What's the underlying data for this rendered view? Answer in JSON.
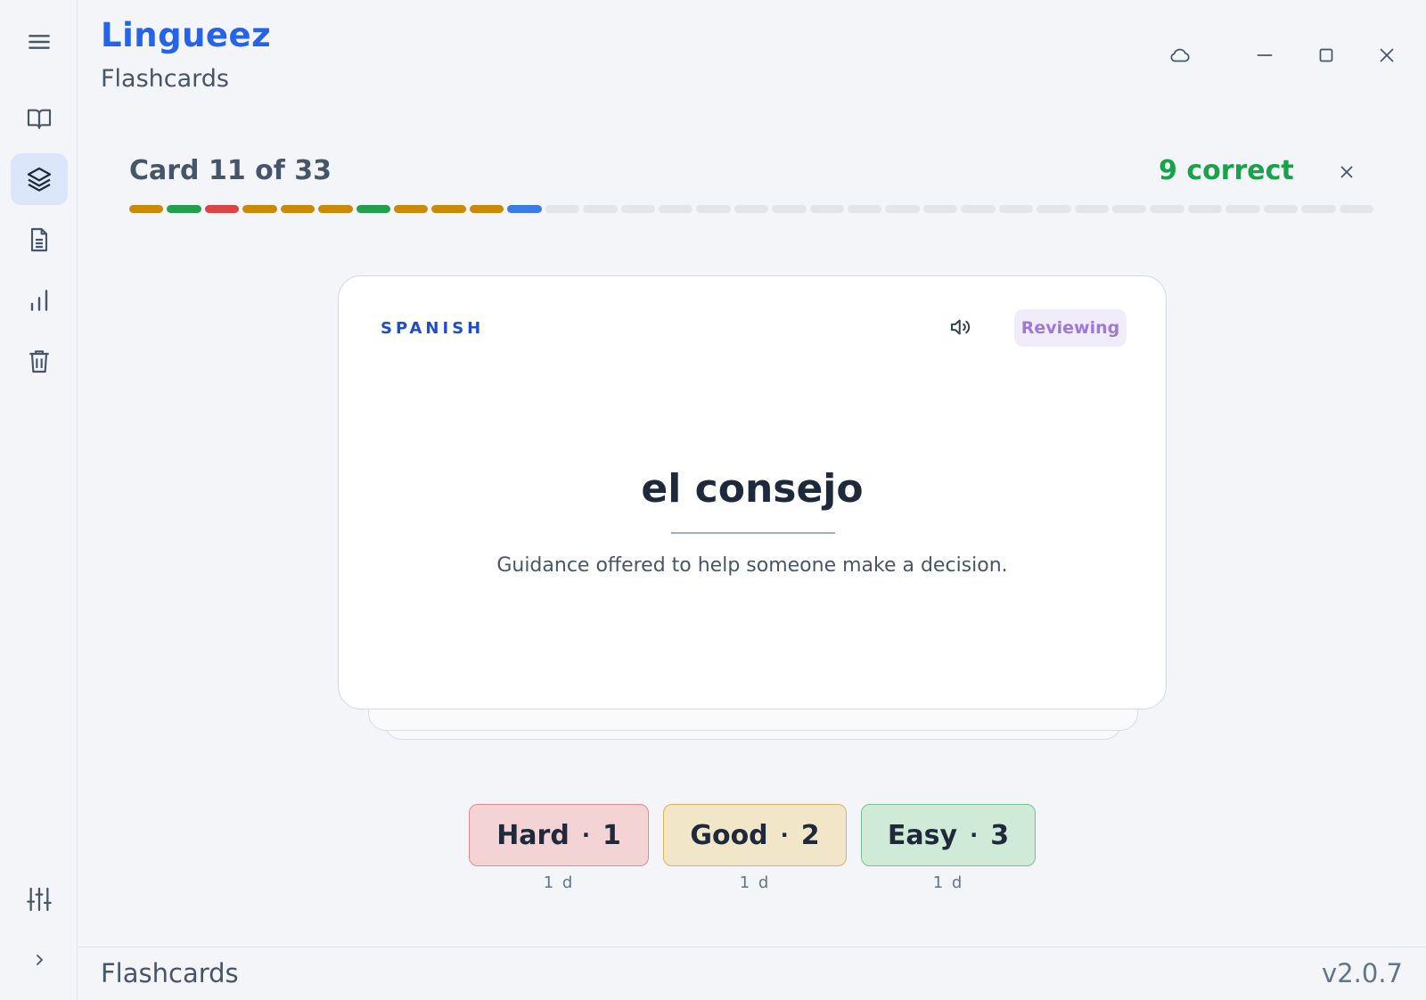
{
  "app": {
    "title": "Lingueez",
    "subtitle": "Flashcards"
  },
  "sidebar": {
    "items": [
      {
        "name": "menu",
        "icon": "hamburger-icon"
      },
      {
        "name": "library",
        "icon": "book-open-icon"
      },
      {
        "name": "flashcards",
        "icon": "layers-icon",
        "active": true
      },
      {
        "name": "notes",
        "icon": "document-icon"
      },
      {
        "name": "stats",
        "icon": "bar-chart-icon"
      },
      {
        "name": "trash",
        "icon": "trash-icon"
      },
      {
        "name": "settings",
        "icon": "sliders-icon"
      },
      {
        "name": "expand",
        "icon": "chevron-right-icon"
      }
    ]
  },
  "window_controls": [
    "cloud-icon",
    "minimize-icon",
    "maximize-icon",
    "close-icon"
  ],
  "session": {
    "card_label": "Card 11 of 33",
    "current_card": 11,
    "total_cards": 33,
    "correct_label": "9 correct",
    "progress": [
      "hard",
      "good",
      "again",
      "hard",
      "hard",
      "hard",
      "good",
      "hard",
      "hard",
      "hard",
      "current"
    ],
    "colors": {
      "hard": "#ca8a04",
      "good": "#22a04b",
      "again": "#dc4545",
      "current": "#3b7be8",
      "pending": "#e2e5ea"
    }
  },
  "card": {
    "language": "SPANISH",
    "status": "Reviewing",
    "term": "el consejo",
    "definition": "Guidance offered to help someone make a decision."
  },
  "ratings": [
    {
      "label": "Hard",
      "key": "1",
      "interval": "1 d",
      "bg": "#f3d3d3",
      "border": "#e08c8c"
    },
    {
      "label": "Good",
      "key": "2",
      "interval": "1 d",
      "bg": "#f2e6c9",
      "border": "#d9b25c"
    },
    {
      "label": "Easy",
      "key": "3",
      "interval": "1 d",
      "bg": "#cfead7",
      "border": "#74c48c"
    }
  ],
  "footer": {
    "label": "Flashcards",
    "version": "v2.0.7"
  }
}
